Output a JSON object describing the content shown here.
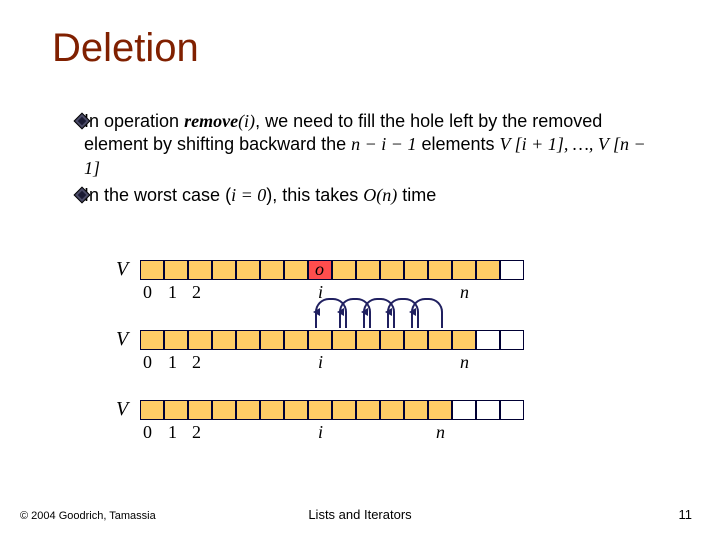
{
  "title": "Deletion",
  "bullets": [
    {
      "pre": "In operation ",
      "fn": "remove",
      "args": "(i)",
      "post": ", we need to fill the hole left by the removed element by shifting backward the ",
      "math": "n − i − 1",
      "post2": " elements ",
      "expr": "V [i + 1], …, V [n − 1]"
    },
    {
      "pre": "In the worst case (",
      "cond": "i = 0",
      "mid": "), this takes ",
      "bigO": "O(n)",
      "post": " time"
    }
  ],
  "arrays": {
    "V": "V",
    "idx0": "0",
    "idx1": "1",
    "idx2": "2",
    "i": "i",
    "n": "n",
    "o": "o"
  },
  "footer": {
    "center": "Lists and Iterators",
    "left": "© 2004 Goodrich, Tamassia",
    "right": "11"
  }
}
